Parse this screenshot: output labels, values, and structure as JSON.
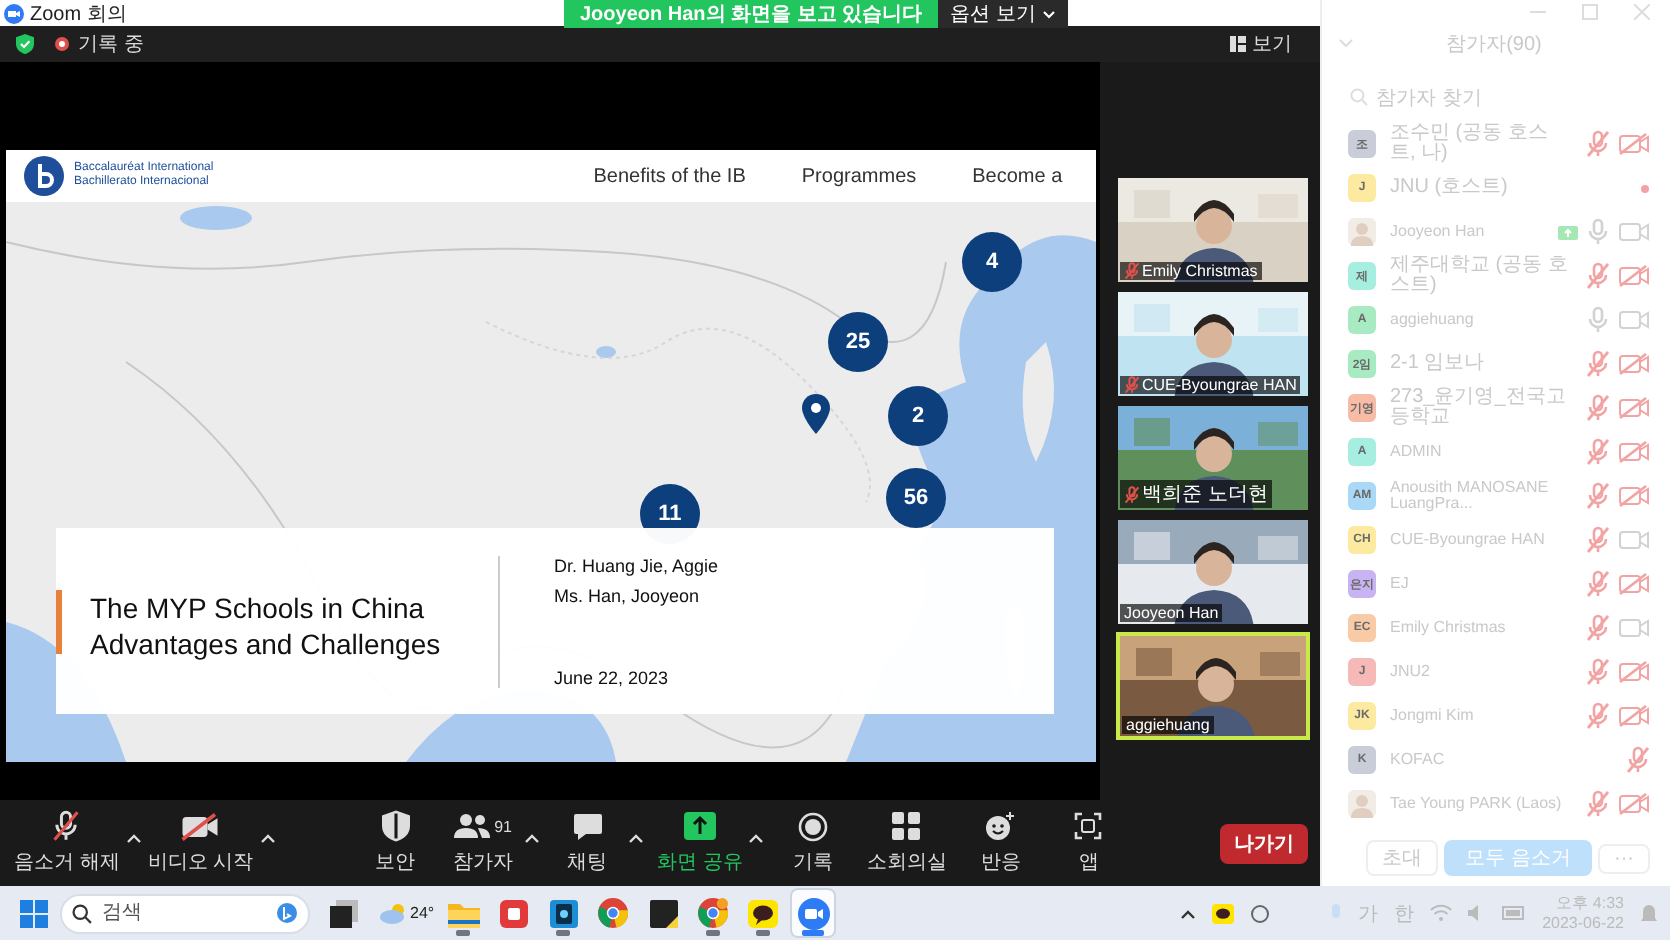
{
  "title_bar": {
    "title": "Zoom 회의"
  },
  "share_banner": {
    "text": "Jooyeon Han의 화면을 보고 있습니다",
    "options": "옵션 보기"
  },
  "top_bar": {
    "recording": "기록 중",
    "view": "보기"
  },
  "shared_screen": {
    "site": {
      "logo_lines": [
        "Baccalauréat International",
        "Bachillerato Internacional"
      ],
      "nav": [
        "Benefits of the IB",
        "Programmes",
        "Become a"
      ]
    },
    "map": {
      "kind": "picture",
      "markers": [
        {
          "kind": "cluster",
          "count": "4"
        },
        {
          "kind": "cluster",
          "count": "25"
        },
        {
          "kind": "cluster",
          "count": "2"
        },
        {
          "kind": "cluster",
          "count": "56"
        },
        {
          "kind": "cluster",
          "count": "11"
        },
        {
          "kind": "pin"
        }
      ]
    },
    "slide": {
      "title_lines": [
        "The MYP Schools in China",
        "Advantages and Challenges"
      ],
      "authors": [
        "Dr. Huang Jie, Aggie",
        "Ms. Han, Jooyeon"
      ],
      "date": "June 22, 2023"
    }
  },
  "video_tiles": [
    {
      "name": "Emily Christmas",
      "muted": true,
      "speaking": false
    },
    {
      "name": "CUE-Byoungrae HAN",
      "muted": true,
      "speaking": false
    },
    {
      "name": "백희준 노더현",
      "muted": true,
      "speaking": false
    },
    {
      "name": "Jooyeon Han",
      "muted": false,
      "speaking": false
    },
    {
      "name": "aggiehuang",
      "muted": false,
      "speaking": true
    }
  ],
  "toolbar": {
    "items": [
      {
        "kind": "mic",
        "label": "음소거 해제",
        "caret": true
      },
      {
        "kind": "video",
        "label": "비디오 시작",
        "caret": true
      },
      {
        "kind": "security",
        "label": "보안",
        "caret": false
      },
      {
        "kind": "participants",
        "label": "참가자",
        "count": "91",
        "caret": true
      },
      {
        "kind": "chat",
        "label": "채팅",
        "caret": true
      },
      {
        "kind": "share",
        "label": "화면 공유",
        "caret": true
      },
      {
        "kind": "record",
        "label": "기록",
        "caret": false
      },
      {
        "kind": "rooms",
        "label": "소회의실",
        "caret": false
      },
      {
        "kind": "reactions",
        "label": "반응",
        "caret": false
      },
      {
        "kind": "apps",
        "label": "앱",
        "caret": false
      }
    ],
    "leave": "나가기"
  },
  "participants_panel": {
    "title": "참가자(90)",
    "search": {
      "placeholder": "참가자 찾기"
    },
    "participants": [
      {
        "name": "조수민 (공동 호스트, 나)",
        "avatar": "조",
        "kind": "initials",
        "color": "#c9cdd8",
        "status_dot": false,
        "muted": true,
        "video_on": false,
        "camera_hidden": false,
        "sharing": false
      },
      {
        "name": "JNU (호스트)",
        "avatar": "J",
        "kind": "initials",
        "color": "#fbeaa0",
        "status_dot": true,
        "sharing": false
      },
      {
        "name": "Jooyeon Han",
        "status_dot": false,
        "muted": false,
        "video_on": true,
        "camera_hidden": false,
        "sharing": true
      },
      {
        "name": "제주대학교 (공동 호스트)",
        "avatar": "제",
        "kind": "initials",
        "color": "#a6eee0",
        "status_dot": false,
        "muted": true,
        "video_on": false,
        "camera_hidden": false,
        "sharing": false
      },
      {
        "name": "aggiehuang",
        "avatar": "A",
        "kind": "initials",
        "color": "#a8ebc2",
        "status_dot": false,
        "muted": false,
        "video_on": true,
        "camera_hidden": false,
        "sharing": false
      },
      {
        "name": "2-1  임보나",
        "avatar": "2임",
        "kind": "initials",
        "color": "#a8ebc2",
        "status_dot": false,
        "muted": true,
        "video_on": false,
        "camera_hidden": false,
        "sharing": false
      },
      {
        "name": "273_윤기영_전국고등학교",
        "avatar": "기영",
        "kind": "initials",
        "color": "#f8bba6",
        "status_dot": false,
        "muted": true,
        "video_on": false,
        "camera_hidden": false,
        "sharing": false
      },
      {
        "name": "ADMIN",
        "avatar": "A",
        "kind": "initials",
        "color": "#a6eee0",
        "status_dot": false,
        "muted": true,
        "video_on": false,
        "camera_hidden": false,
        "sharing": false
      },
      {
        "name": "Anousith MANOSANE LuangPra...",
        "avatar": "AM",
        "kind": "initials",
        "color": "#a9d9f6",
        "status_dot": false,
        "muted": true,
        "video_on": false,
        "camera_hidden": false,
        "sharing": false
      },
      {
        "name": "CUE-Byoungrae HAN",
        "avatar": "CH",
        "kind": "initials",
        "color": "#fbeaa0",
        "status_dot": false,
        "muted": true,
        "video_on": true,
        "camera_hidden": false,
        "sharing": false
      },
      {
        "name": "EJ",
        "avatar": "은지",
        "kind": "initials",
        "color": "#c8b4f2",
        "status_dot": false,
        "muted": true,
        "video_on": false,
        "camera_hidden": false,
        "sharing": false
      },
      {
        "name": "Emily Christmas",
        "avatar": "EC",
        "kind": "initials",
        "color": "#f9caa6",
        "status_dot": false,
        "muted": true,
        "video_on": true,
        "camera_hidden": false,
        "sharing": false
      },
      {
        "name": "JNU2",
        "avatar": "J",
        "kind": "initials",
        "color": "#f7b8b8",
        "status_dot": false,
        "muted": true,
        "video_on": false,
        "camera_hidden": false,
        "sharing": false
      },
      {
        "name": "Jongmi Kim",
        "avatar": "JK",
        "kind": "initials",
        "color": "#fbeaa0",
        "status_dot": false,
        "muted": true,
        "video_on": false,
        "camera_hidden": false,
        "sharing": false
      },
      {
        "name": "KOFAC",
        "avatar": "K",
        "kind": "initials",
        "color": "#c9cdd8",
        "status_dot": false,
        "muted": true,
        "camera_hidden": true,
        "sharing": false
      },
      {
        "name": "Tae Young PARK (Laos)",
        "status_dot": false,
        "muted": true,
        "video_on": false,
        "camera_hidden": false,
        "sharing": false
      }
    ],
    "buttons": [
      "초대",
      "모두 음소거",
      "···"
    ]
  },
  "taskbar": {
    "search": {
      "placeholder": "검색"
    },
    "weather": "24°",
    "apps": [
      {
        "kind": "taskview",
        "running": false,
        "selected": false
      },
      {
        "kind": "folder",
        "running": true,
        "selected": false
      },
      {
        "kind": "red",
        "running": false,
        "selected": false
      },
      {
        "kind": "blue",
        "running": true,
        "selected": false
      },
      {
        "kind": "browser",
        "running": false,
        "selected": false
      },
      {
        "kind": "note",
        "running": false,
        "selected": false
      },
      {
        "kind": "browser-badge",
        "running": true,
        "selected": false
      },
      {
        "kind": "chat",
        "running": true,
        "selected": false
      },
      {
        "kind": "meeting",
        "running": true,
        "selected": true
      }
    ],
    "tray": {
      "ime": [
        "가",
        "한"
      ],
      "time": "오후 4:33",
      "date": "2023-06-22"
    }
  }
}
